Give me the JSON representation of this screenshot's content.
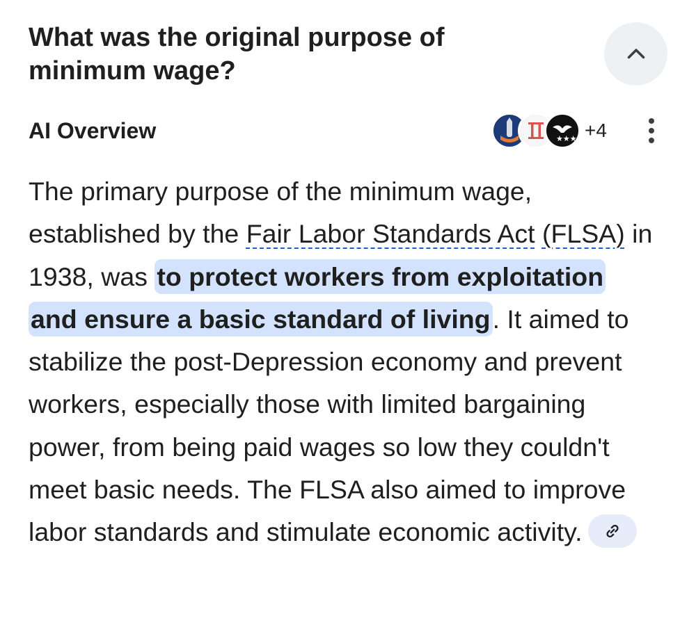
{
  "question": "What was the original purpose of minimum wage?",
  "overview": {
    "label": "AI Overview",
    "source_icons": [
      "source-icon-rocket",
      "source-icon-roman-two",
      "source-icon-eagle-stars"
    ],
    "more_sources": "+4",
    "menu_icon": "more-vert-icon",
    "collapse_icon": "chevron-up-icon"
  },
  "answer": {
    "intro": "The primary purpose of the minimum wage, established by the ",
    "act_link": "Fair Labor Standards Act",
    "space": " ",
    "flsa_link": "(FLSA)",
    "mid": " in 1938, was ",
    "highlight": "to protect workers from exploitation and ensure a basic standard of living",
    "rest": ". It aimed to stabilize the post-Depression economy and prevent workers, especially those with limited bargaining power, from being paid wages so low they couldn't meet basic needs. The FLSA also aimed to improve labor standards and stimulate economic activity.",
    "cite_icon": "link-icon"
  },
  "colors": {
    "highlight": "#d3e3fd",
    "link_underline": "#1a5fd0",
    "chip": "#e7ecfb",
    "collapse_bg": "#edf1f4"
  }
}
